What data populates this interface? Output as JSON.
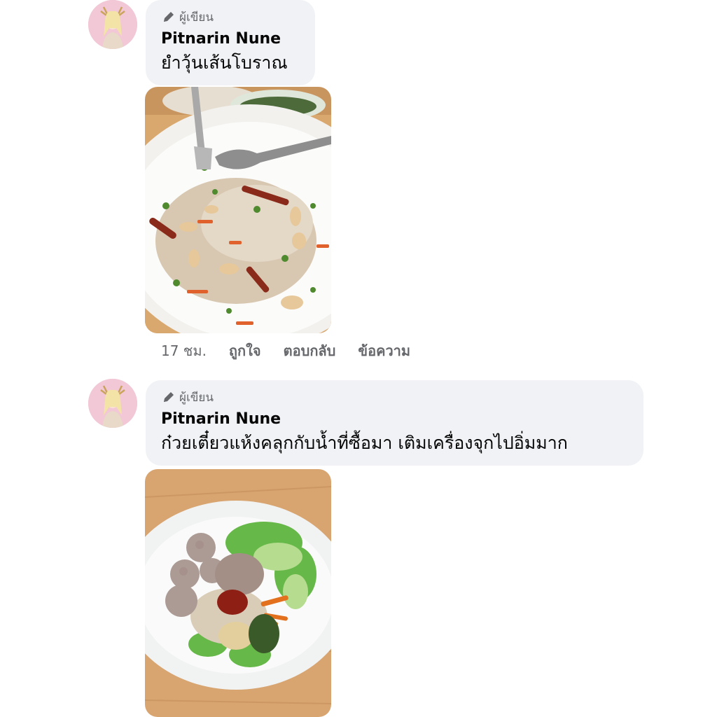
{
  "comments": [
    {
      "author_badge": "ผู้เขียน",
      "author_badge_icon": "pencil-icon",
      "author_name": "Pitnarin Nune",
      "text": "ยำวุ้นเส้นโบราณ",
      "photo": "glass-noodle-salad-photo",
      "time": "17 ชม.",
      "like_label": "ถูกใจ",
      "reply_label": "ตอบกลับ",
      "message_label": "ข้อความ"
    },
    {
      "author_badge": "ผู้เขียน",
      "author_badge_icon": "pencil-icon",
      "author_name": "Pitnarin Nune",
      "text": "ก๋วยเตี๋ยวแห้งคลุกกับน้ำที่ซื้อมา เติมเครื่องจุกไปอิ่มมาก",
      "photo": "dry-noodle-bowl-photo"
    }
  ],
  "colors": {
    "bubble": "#f0f2f5",
    "secondary_text": "#65676b",
    "avatar_bg": "#f2c7d6"
  }
}
